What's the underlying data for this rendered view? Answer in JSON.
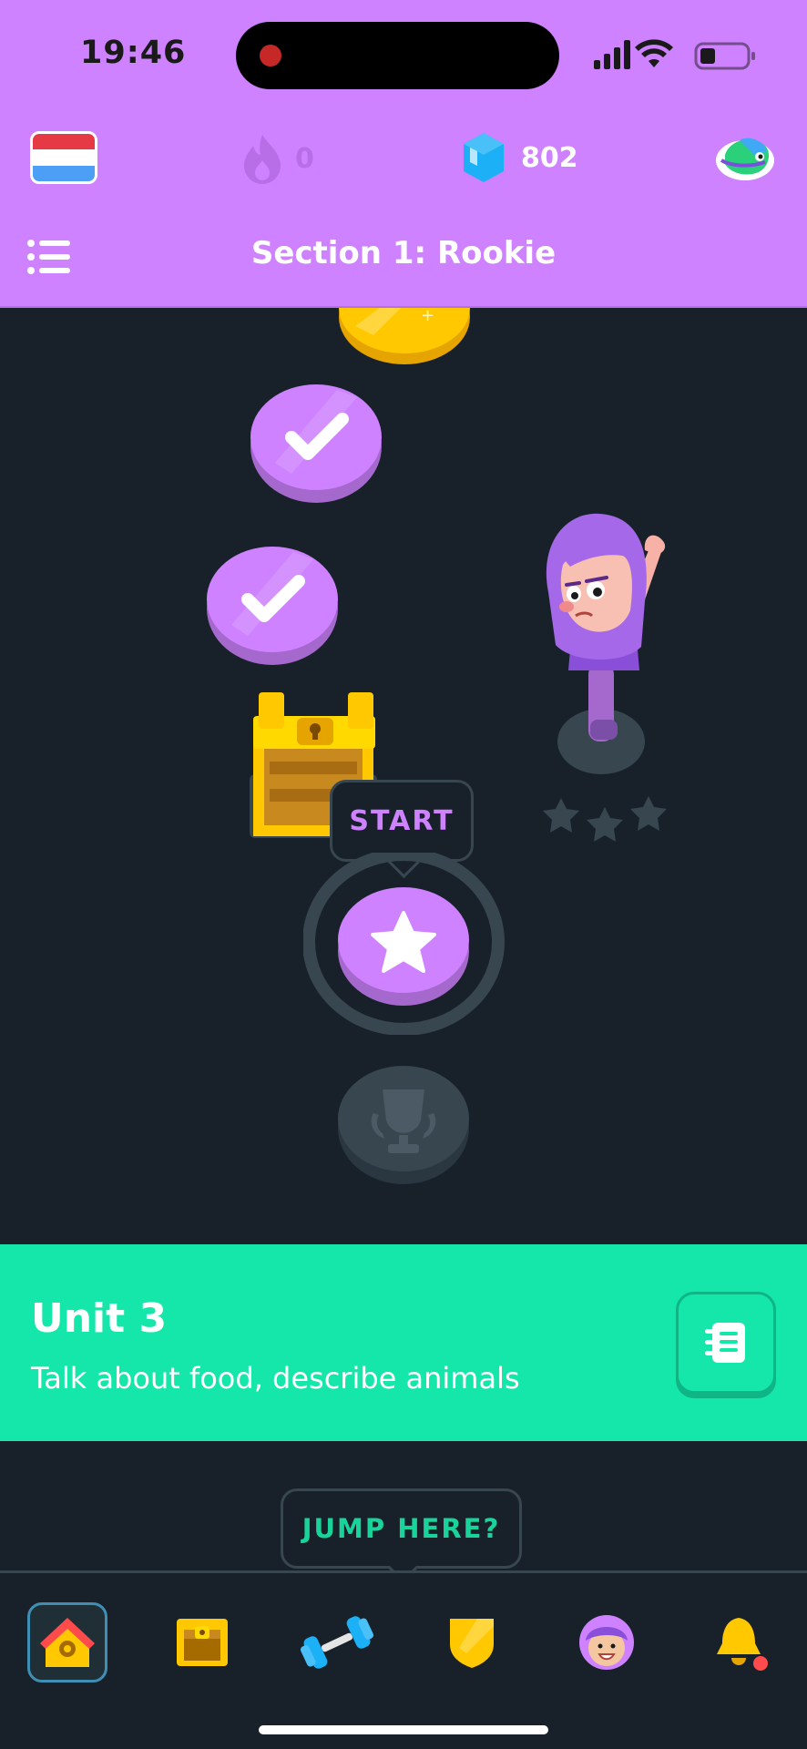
{
  "status_bar": {
    "time": "19:46"
  },
  "header": {
    "streak_count": "0",
    "gems_count": "802",
    "section_title": "Section 1: Rookie"
  },
  "path": {
    "start_label": "START",
    "characters": "2",
    "nodes": [
      {
        "state": "completed",
        "icon": "check-icon"
      },
      {
        "state": "completed",
        "icon": "check-icon"
      },
      {
        "state": "chest",
        "icon": "treasure-chest-icon"
      },
      {
        "state": "current",
        "icon": "star-icon"
      },
      {
        "state": "locked",
        "icon": "trophy-icon"
      }
    ]
  },
  "unit": {
    "title": "Unit 3",
    "subtitle": "Talk about food, describe animals"
  },
  "jump_label": "JUMP HERE?",
  "nav": [
    {
      "name": "home",
      "icon": "house-icon",
      "active": true
    },
    {
      "name": "shop",
      "icon": "treasure-chest-icon",
      "active": false
    },
    {
      "name": "practice",
      "icon": "dumbbell-icon",
      "active": false
    },
    {
      "name": "leagues",
      "icon": "shield-icon",
      "active": false
    },
    {
      "name": "profile",
      "icon": "avatar-icon",
      "active": false
    },
    {
      "name": "notifications",
      "icon": "bell-icon",
      "active": false
    }
  ],
  "colors": {
    "header": "#ce82ff",
    "background": "#18212a",
    "unit_banner": "#15e6aa",
    "node_purple": "#ce82ff"
  }
}
